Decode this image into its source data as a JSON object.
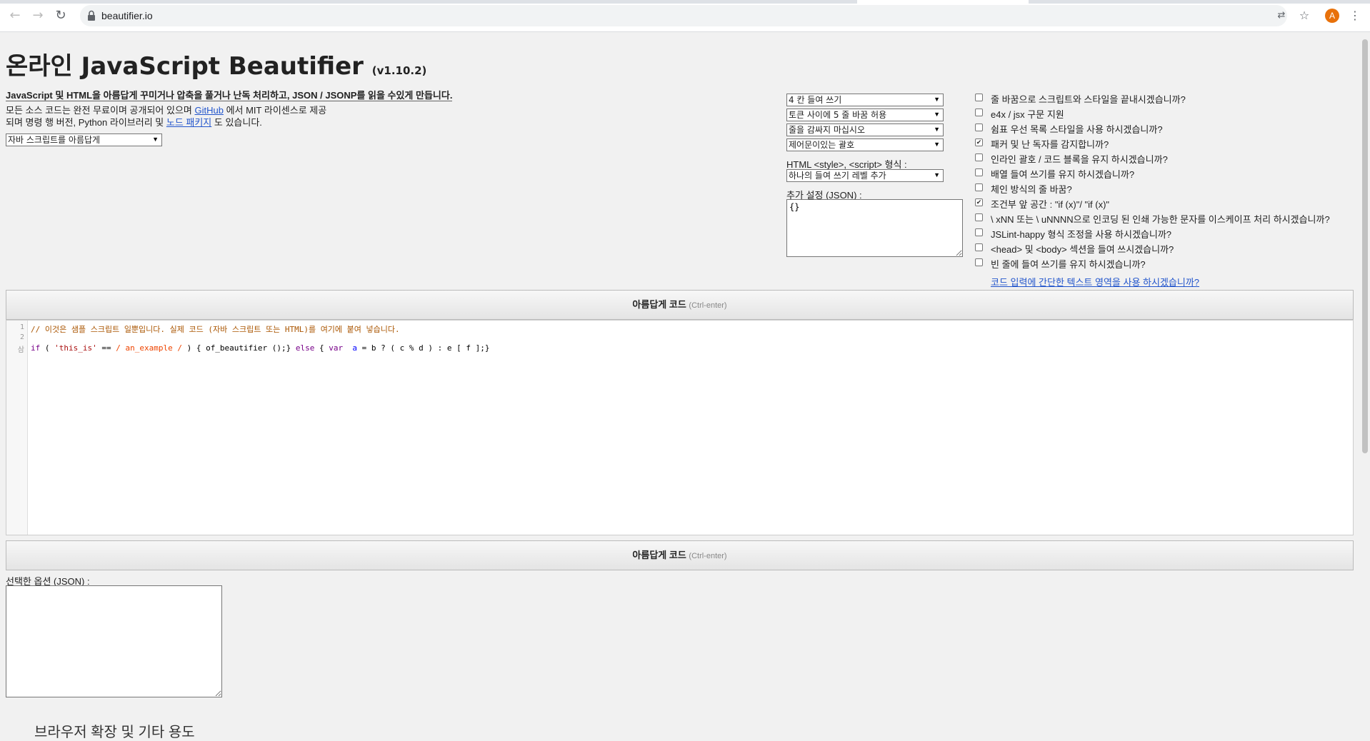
{
  "browser": {
    "url": "beautifier.io",
    "avatar_letter": "A",
    "icons": [
      "back-icon",
      "forward-icon",
      "reload-icon",
      "lock-icon",
      "translate-icon",
      "star-icon",
      "menu-icon"
    ]
  },
  "page": {
    "title": "온라인 JavaScript Beautifier",
    "version": "(v1.10.2)",
    "tagline": "JavaScript 및 HTML을 아름답게 꾸미거나 압축을 풀거나 난독 처리하고, JSON / JSONP를 읽을 수있게 만듭니다.",
    "intro": {
      "part1": "모든 소스 코드는 완전 무료이며 공개되어 있으며 ",
      "github_link": "GitHub",
      "part2": " 에서 MIT 라이센스로 제공",
      "part3": "되며 명령 행 버전, Python 라이브러리 및 ",
      "node_link": "노드 패키지",
      "part4": " 도 있습니다."
    },
    "language_select": "자바 스크립트를 아름답게"
  },
  "options": {
    "indent": "4 칸 들여 쓰기",
    "newlines": "토큰 사이에 5 줄 바꿈 허용",
    "wrap": "줄을 감싸지 마십시오",
    "brace": "제어문이있는 괄호",
    "html_label": "HTML <style>, <script> 형식 :",
    "html_select": "하나의 들여 쓰기 레벨 추가",
    "extra_label": "추가 설정 (JSON) :",
    "extra_value": "{}"
  },
  "checkboxes": [
    {
      "label": "줄 바꿈으로 스크립트와 스타일을 끝내시겠습니까?",
      "checked": false
    },
    {
      "label": "e4x / jsx 구문 지원",
      "checked": false
    },
    {
      "label": "쉼표 우선 목록 스타일을 사용 하시겠습니까?",
      "checked": false
    },
    {
      "label": "패커 및 난 독자를 감지합니까?",
      "checked": true
    },
    {
      "label": "인라인 괄호 / 코드 블록을 유지 하시겠습니까?",
      "checked": false
    },
    {
      "label": "배열 들여 쓰기를 유지 하시겠습니까?",
      "checked": false
    },
    {
      "label": "체인 방식의 줄 바꿈?",
      "checked": false
    },
    {
      "label": "조건부 앞 공간 : \"if (x)\"/ \"if (x)\"",
      "checked": true
    },
    {
      "label": "\\ xNN 또는 \\ uNNNN으로 인코딩 된 인쇄 가능한 문자를 이스케이프 처리 하시겠습니까?",
      "checked": false
    },
    {
      "label": "JSLint-happy 형식 조정을 사용 하시겠습니까?",
      "checked": false
    },
    {
      "label": "<head> 및 <body> 섹션을 들여 쓰시겠습니까?",
      "checked": false
    },
    {
      "label": "빈 줄에 들여 쓰기를 유지 하시겠습니까?",
      "checked": false
    }
  ],
  "textarea_link": "코드 입력에 간단한 텍스트 영역을 사용 하시겠습니까?",
  "beautify_button": {
    "label": "아름답게 코드",
    "hint": "(Ctrl-enter)"
  },
  "editor": {
    "line_numbers": [
      "1",
      "2",
      "삼"
    ],
    "line1_comment": "// 이것은 샘플 스크립트 일뿐입니다. 실제 코드 (자바 스크립트 또는 HTML)를 여기에 붙여 넣습니다.",
    "line3": {
      "if": "if",
      "p1": " ( ",
      "str": "'this_is'",
      "p2": " == ",
      "re": "/ an_example /",
      "p3": " ) { of_beautifier ();} ",
      "else": "else",
      "p4": " { ",
      "var": "var",
      "p5": "  ",
      "a": "a",
      "p6": " = b ? ( c % d ) : e [ f ];}"
    }
  },
  "selected_options_label": "선택한 옵션 (JSON) :",
  "footer_heading": "브라우저 확장 및 기타 용도"
}
